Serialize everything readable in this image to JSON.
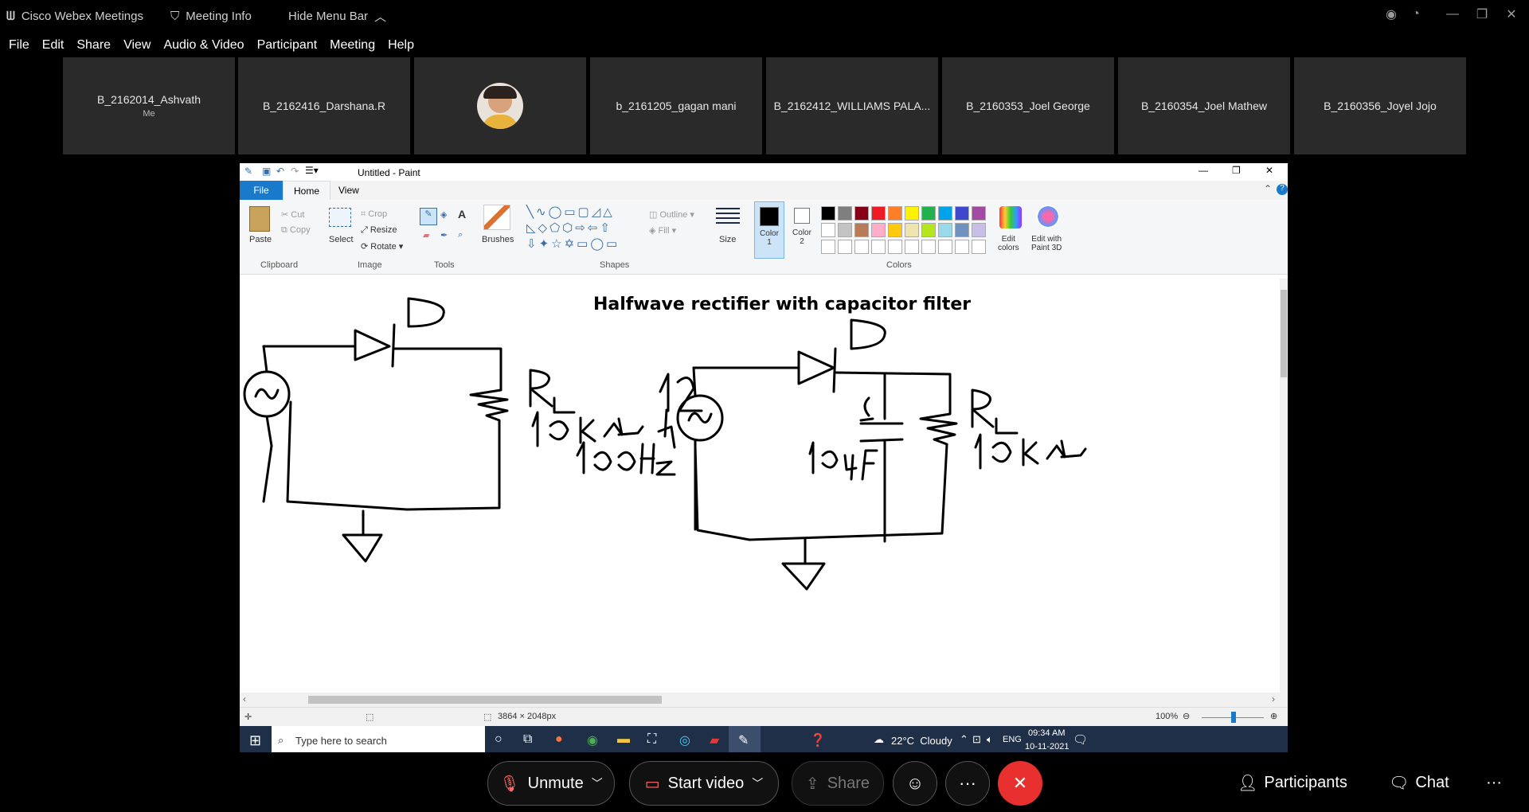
{
  "titlebar": {
    "app_name": "Cisco Webex Meetings",
    "meeting_info": "Meeting Info",
    "hide_menu": "Hide Menu Bar"
  },
  "menubar": [
    "File",
    "Edit",
    "Share",
    "View",
    "Audio & Video",
    "Participant",
    "Meeting",
    "Help"
  ],
  "participants": [
    {
      "name": "B_2162014_Ashvath",
      "sub": "Me"
    },
    {
      "name": "B_2162416_Darshana.R",
      "sub": ""
    },
    {
      "name": "",
      "sub": "",
      "avatar": true
    },
    {
      "name": "b_2161205_gagan mani",
      "sub": ""
    },
    {
      "name": "B_2162412_WILLIAMS PALA...",
      "sub": ""
    },
    {
      "name": "B_2160353_Joel George",
      "sub": ""
    },
    {
      "name": "B_2160354_Joel Mathew",
      "sub": ""
    },
    {
      "name": "B_2160356_Joyel Jojo",
      "sub": ""
    }
  ],
  "paint": {
    "title": "Untitled - Paint",
    "tabs": [
      "File",
      "Home",
      "View"
    ],
    "clipboard": {
      "paste": "Paste",
      "cut": "Cut",
      "copy": "Copy",
      "label": "Clipboard"
    },
    "image": {
      "select": "Select",
      "crop": "Crop",
      "resize": "Resize",
      "rotate": "Rotate",
      "label": "Image"
    },
    "tools": {
      "label": "Tools"
    },
    "brushes": "Brushes",
    "shapes": {
      "outline": "Outline",
      "fill": "Fill",
      "label": "Shapes"
    },
    "size": "Size",
    "color1": "Color\n1",
    "color2": "Color\n2",
    "colors_label": "Colors",
    "edit_colors": "Edit\ncolors",
    "edit_3d": "Edit with\nPaint 3D",
    "palette_row1": [
      "#000000",
      "#7f7f7f",
      "#880015",
      "#ed1c24",
      "#ff7f27",
      "#fff200",
      "#22b14c",
      "#00a2e8",
      "#3f48cc",
      "#a349a4"
    ],
    "palette_row2": [
      "#ffffff",
      "#c3c3c3",
      "#b97a57",
      "#ffaec9",
      "#ffc90e",
      "#efe4b0",
      "#b5e61d",
      "#99d9ea",
      "#7092be",
      "#c8bfe7"
    ],
    "canvas_heading": "Halfwave rectifier with capacitor filter",
    "dimensions": "3864 × 2048px",
    "zoom": "100%"
  },
  "win_taskbar": {
    "search_placeholder": "Type here to search",
    "weather": "22°C  Cloudy",
    "lang": "ENG",
    "time": "09:34 AM",
    "date": "10-11-2021"
  },
  "controls": {
    "unmute": "Unmute",
    "start_video": "Start video",
    "share": "Share",
    "participants": "Participants",
    "chat": "Chat"
  }
}
